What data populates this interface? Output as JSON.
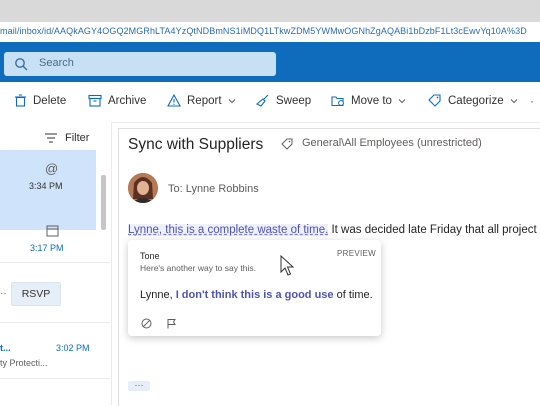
{
  "browser": {
    "url": "mail/inbox/id/AAQkAGY4OGQ2MGRhLTA4YzQtNDBmNS1iMDQ1LTkwZDM5YWMwOGNhZgAQABi1bDzbF1Lt3cEwvYq10A%3D"
  },
  "header": {
    "search_placeholder": "Search"
  },
  "toolbar": {
    "delete": "Delete",
    "archive": "Archive",
    "report": "Report",
    "sweep": "Sweep",
    "move_to": "Move to",
    "categorize": "Categorize"
  },
  "message_list": {
    "filter_label": "Filter",
    "item1_time": "3:34 PM",
    "item2_time": "3:17 PM",
    "rsvp_label": "RSVP",
    "item3_sender": "t...",
    "item3_time": "3:02 PM",
    "item3_preview": "ty Protecti..."
  },
  "reading": {
    "subject": "Sync with Suppliers",
    "sensitivity_label": "General\\All Employees (unrestricted)",
    "to_line": "To:  Lynne Robbins",
    "flagged_text": "Lynne, this is a complete waste of time.",
    "body_rest": " It was decided late Friday that all project m"
  },
  "suggestion_card": {
    "title": "Tone",
    "subtitle": "Here's another way to say this.",
    "preview_badge": "PREVIEW",
    "suggest_prefix": "Lynne, ",
    "suggest_emph": "I don't think this is a good use",
    "suggest_suffix": " of time."
  },
  "colors": {
    "brand": "#0f6cbd",
    "search_bg": "#c7e0f4",
    "selected": "#cfe4fa",
    "highlight": "#4f52b2"
  }
}
